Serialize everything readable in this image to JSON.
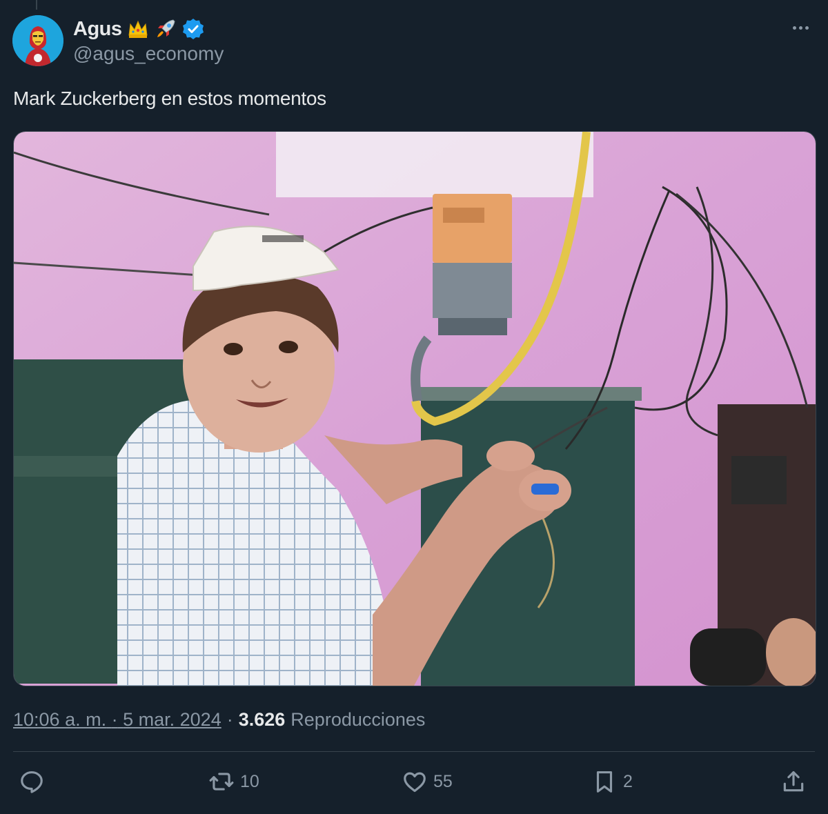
{
  "tweet": {
    "author": {
      "display_name": "Agus",
      "handle": "@agus_economy",
      "emoji_badges": [
        "crown-emoji",
        "rocket-emoji"
      ],
      "verified": true
    },
    "text": "Mark Zuckerberg en estos momentos",
    "time": "10:06 a. m.",
    "date": "5 mar. 2024",
    "separator": "·",
    "views_count": "3.626",
    "views_label": "Reproducciones",
    "actions": {
      "replies": "",
      "reposts": "10",
      "likes": "55",
      "bookmarks": "2"
    }
  },
  "colors": {
    "background": "#15202b",
    "text": "#e7e9ea",
    "muted": "#8b98a5",
    "verified": "#1d9bf0",
    "divider": "#38444d"
  }
}
